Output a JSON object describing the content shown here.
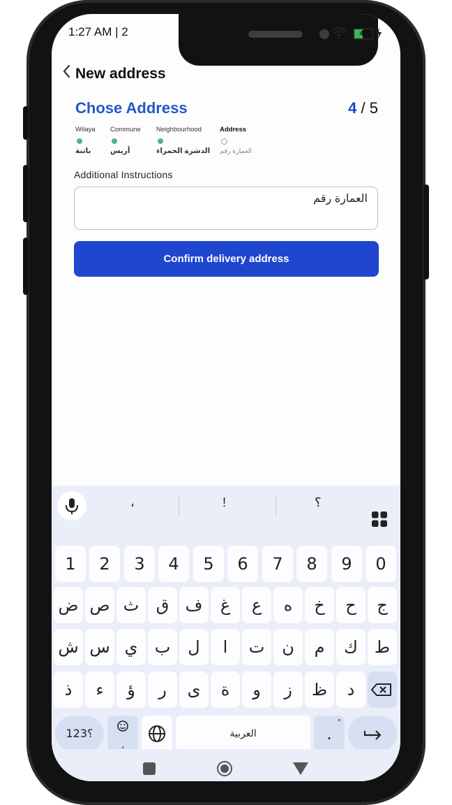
{
  "status_bar": {
    "time": "1:27 AM | 2",
    "battery": "43"
  },
  "header": {
    "title": "New address"
  },
  "section": {
    "title": "Chose Address",
    "step_current": "4",
    "step_sep": "/",
    "step_total": "5"
  },
  "steps": [
    {
      "label": "Wilaya",
      "value": "باتنة",
      "done": true
    },
    {
      "label": "Commune",
      "value": "أريس",
      "done": true
    },
    {
      "label": "Neighbourhood",
      "value": "الدشرة الحمراء",
      "done": true
    },
    {
      "label": "Address",
      "value": "العمارة رقم",
      "done": false
    }
  ],
  "form": {
    "label": "Additional Instructions",
    "value": "العمارة رقم"
  },
  "confirm_button": "Confirm delivery address",
  "keyboard": {
    "suggestions": [
      "،",
      "!",
      "؟"
    ],
    "row_numbers": [
      "1",
      "2",
      "3",
      "4",
      "5",
      "6",
      "7",
      "8",
      "9",
      "0"
    ],
    "row1": [
      "ض",
      "ص",
      "ث",
      "ق",
      "ف",
      "غ",
      "ع",
      "ه",
      "خ",
      "ح",
      "ج"
    ],
    "row2": [
      "ش",
      "س",
      "ي",
      "ب",
      "ل",
      "ا",
      "ت",
      "ن",
      "م",
      "ك",
      "ط"
    ],
    "row3": [
      "ذ",
      "ء",
      "ؤ",
      "ر",
      "ى",
      "ة",
      "و",
      "ز",
      "ظ",
      "د"
    ],
    "symbols_key": "؟123",
    "emoji_key_sub": "،",
    "space_label": "العربية",
    "period_key": ".",
    "period_key_sub": "°"
  }
}
